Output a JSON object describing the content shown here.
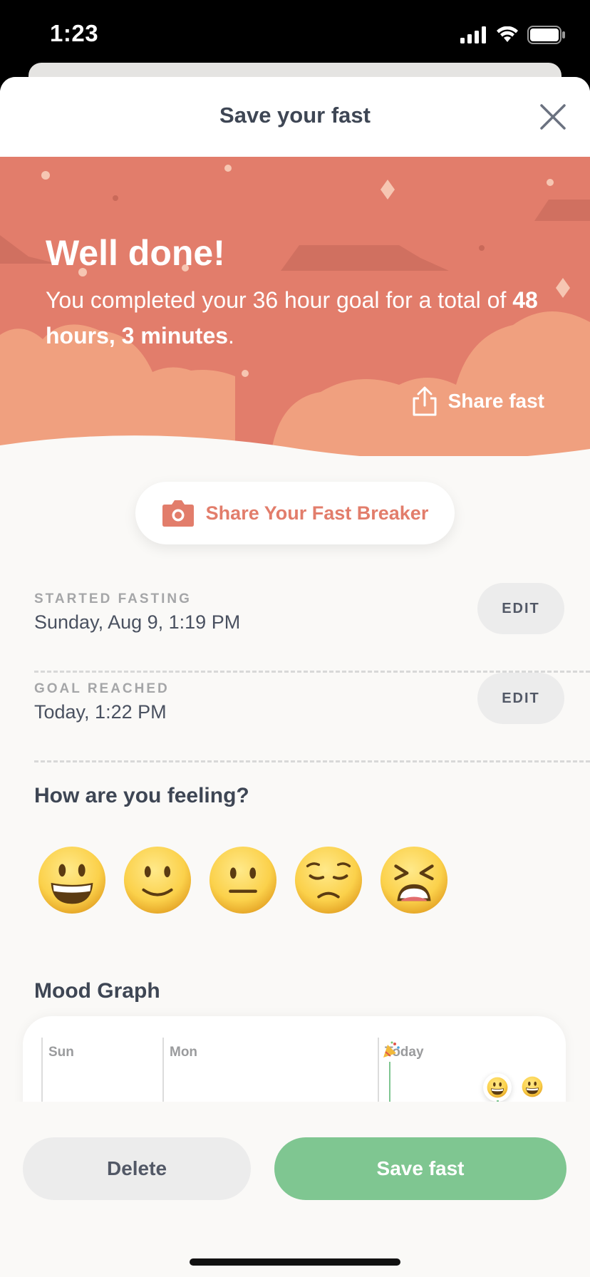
{
  "status_bar": {
    "time": "1:23"
  },
  "header": {
    "title": "Save your fast",
    "close_icon": "close-icon"
  },
  "hero": {
    "title": "Well done!",
    "text_prefix": "You completed your 36 hour goal for a total of ",
    "text_bold": "48 hours, 3 minutes",
    "text_suffix": ".",
    "share_label": "Share fast",
    "share_icon": "share-icon",
    "bg_color": "#e27d6b",
    "cloud_color": "#f0a07f"
  },
  "fast_breaker": {
    "label": "Share Your Fast Breaker",
    "icon": "camera-icon",
    "color": "#e27d6b"
  },
  "started": {
    "label": "STARTED FASTING",
    "value": "Sunday, Aug 9, 1:19 PM",
    "edit_label": "EDIT"
  },
  "goal": {
    "label": "GOAL REACHED",
    "value": "Today, 1:22 PM",
    "edit_label": "EDIT"
  },
  "feeling": {
    "title": "How are you feeling?",
    "moods": [
      "grinning-face",
      "slightly-smiling-face",
      "neutral-face",
      "pensive-face",
      "tired-face"
    ]
  },
  "mood_graph": {
    "title": "Mood Graph",
    "days": [
      "Sun",
      "Mon",
      "Today"
    ],
    "marker_icon": "party-popper-icon"
  },
  "actions": {
    "delete_label": "Delete",
    "save_label": "Save fast",
    "save_color": "#7fc691"
  }
}
